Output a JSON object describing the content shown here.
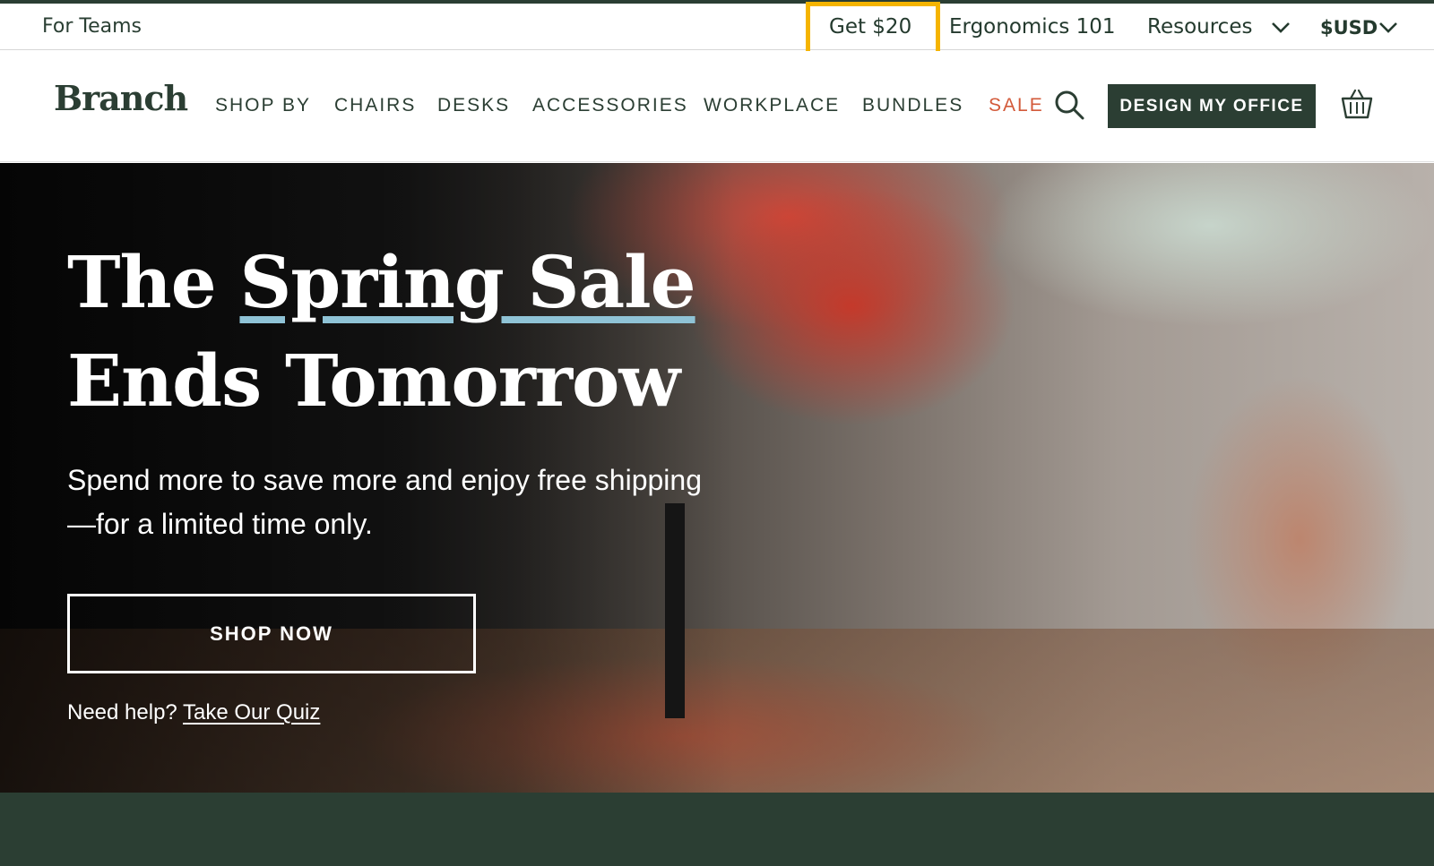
{
  "utility_bar": {
    "for_teams": "For Teams",
    "get_20": "Get $20",
    "ergonomics": "Ergonomics 101",
    "resources": "Resources",
    "currency": "$USD"
  },
  "nav": {
    "logo": "Branch",
    "items": [
      "SHOP BY",
      "CHAIRS",
      "DESKS",
      "ACCESSORIES",
      "WORKPLACE",
      "BUNDLES",
      "SALE"
    ],
    "design_button": "DESIGN MY OFFICE"
  },
  "hero": {
    "headline_1": "The ",
    "headline_highlight": "Spring Sale",
    "headline_2": "Ends Tomorrow",
    "subhead": "Spend more to save more and enjoy free shipping—for a limited time only.",
    "shop_button": "SHOP NOW",
    "help_text": "Need help? ",
    "quiz_link": "Take Our Quiz"
  },
  "colors": {
    "brand_green": "#2b3e33",
    "sale_orange": "#d35a3a",
    "highlight_box": "#f5b400",
    "underline_blue": "#8fc3d6"
  },
  "icons": {
    "search": "search-icon",
    "cart": "cart-icon",
    "chevron": "chevron-down-icon"
  }
}
